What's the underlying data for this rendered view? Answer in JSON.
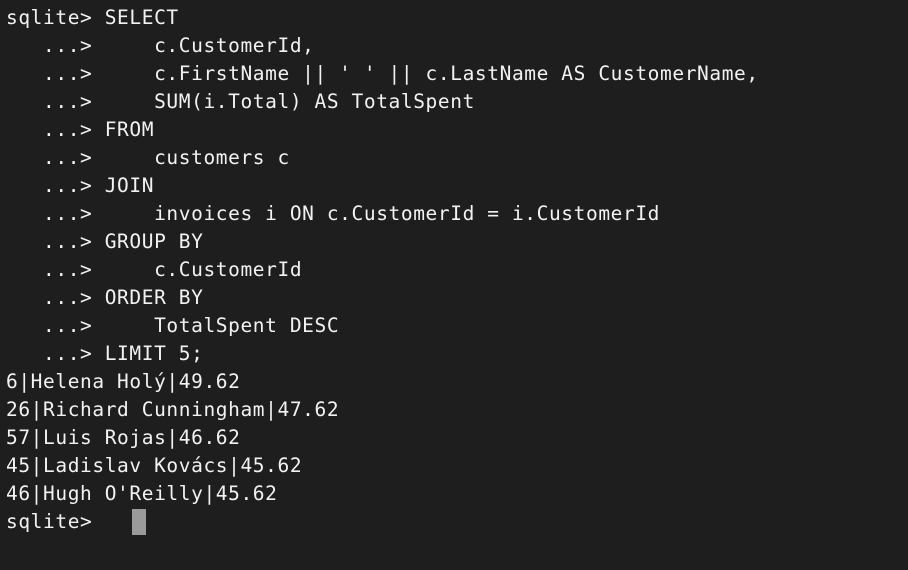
{
  "terminal": {
    "query_lines": [
      "sqlite> SELECT",
      "   ...>     c.CustomerId,",
      "   ...>     c.FirstName || ' ' || c.LastName AS CustomerName,",
      "   ...>     SUM(i.Total) AS TotalSpent",
      "   ...> FROM",
      "   ...>     customers c",
      "   ...> JOIN",
      "   ...>     invoices i ON c.CustomerId = i.CustomerId",
      "   ...> GROUP BY",
      "   ...>     c.CustomerId",
      "   ...> ORDER BY",
      "   ...>     TotalSpent DESC",
      "   ...> LIMIT 5;"
    ],
    "result_rows": [
      "6|Helena Holý|49.62",
      "26|Richard Cunningham|47.62",
      "57|Luis Rojas|46.62",
      "45|Ladislav Kovács|45.62",
      "46|Hugh O'Reilly|45.62"
    ],
    "prompt": "sqlite>"
  },
  "colors": {
    "background": "#1e1e1e",
    "text": "#f2f2f2",
    "cursor": "#9a9a9a"
  }
}
